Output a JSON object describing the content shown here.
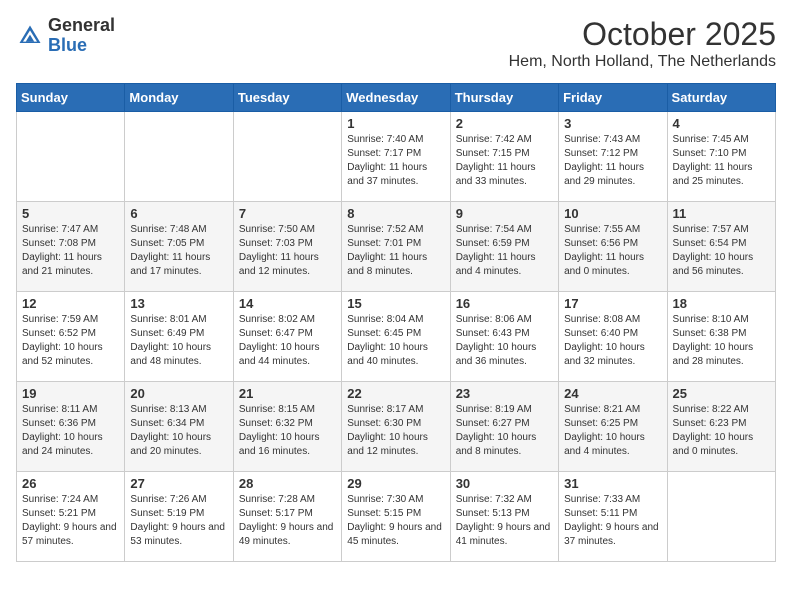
{
  "logo": {
    "general": "General",
    "blue": "Blue"
  },
  "header": {
    "month": "October 2025",
    "location": "Hem, North Holland, The Netherlands"
  },
  "weekdays": [
    "Sunday",
    "Monday",
    "Tuesday",
    "Wednesday",
    "Thursday",
    "Friday",
    "Saturday"
  ],
  "weeks": [
    [
      {
        "day": "",
        "sunrise": "",
        "sunset": "",
        "daylight": ""
      },
      {
        "day": "",
        "sunrise": "",
        "sunset": "",
        "daylight": ""
      },
      {
        "day": "",
        "sunrise": "",
        "sunset": "",
        "daylight": ""
      },
      {
        "day": "1",
        "sunrise": "Sunrise: 7:40 AM",
        "sunset": "Sunset: 7:17 PM",
        "daylight": "Daylight: 11 hours and 37 minutes."
      },
      {
        "day": "2",
        "sunrise": "Sunrise: 7:42 AM",
        "sunset": "Sunset: 7:15 PM",
        "daylight": "Daylight: 11 hours and 33 minutes."
      },
      {
        "day": "3",
        "sunrise": "Sunrise: 7:43 AM",
        "sunset": "Sunset: 7:12 PM",
        "daylight": "Daylight: 11 hours and 29 minutes."
      },
      {
        "day": "4",
        "sunrise": "Sunrise: 7:45 AM",
        "sunset": "Sunset: 7:10 PM",
        "daylight": "Daylight: 11 hours and 25 minutes."
      }
    ],
    [
      {
        "day": "5",
        "sunrise": "Sunrise: 7:47 AM",
        "sunset": "Sunset: 7:08 PM",
        "daylight": "Daylight: 11 hours and 21 minutes."
      },
      {
        "day": "6",
        "sunrise": "Sunrise: 7:48 AM",
        "sunset": "Sunset: 7:05 PM",
        "daylight": "Daylight: 11 hours and 17 minutes."
      },
      {
        "day": "7",
        "sunrise": "Sunrise: 7:50 AM",
        "sunset": "Sunset: 7:03 PM",
        "daylight": "Daylight: 11 hours and 12 minutes."
      },
      {
        "day": "8",
        "sunrise": "Sunrise: 7:52 AM",
        "sunset": "Sunset: 7:01 PM",
        "daylight": "Daylight: 11 hours and 8 minutes."
      },
      {
        "day": "9",
        "sunrise": "Sunrise: 7:54 AM",
        "sunset": "Sunset: 6:59 PM",
        "daylight": "Daylight: 11 hours and 4 minutes."
      },
      {
        "day": "10",
        "sunrise": "Sunrise: 7:55 AM",
        "sunset": "Sunset: 6:56 PM",
        "daylight": "Daylight: 11 hours and 0 minutes."
      },
      {
        "day": "11",
        "sunrise": "Sunrise: 7:57 AM",
        "sunset": "Sunset: 6:54 PM",
        "daylight": "Daylight: 10 hours and 56 minutes."
      }
    ],
    [
      {
        "day": "12",
        "sunrise": "Sunrise: 7:59 AM",
        "sunset": "Sunset: 6:52 PM",
        "daylight": "Daylight: 10 hours and 52 minutes."
      },
      {
        "day": "13",
        "sunrise": "Sunrise: 8:01 AM",
        "sunset": "Sunset: 6:49 PM",
        "daylight": "Daylight: 10 hours and 48 minutes."
      },
      {
        "day": "14",
        "sunrise": "Sunrise: 8:02 AM",
        "sunset": "Sunset: 6:47 PM",
        "daylight": "Daylight: 10 hours and 44 minutes."
      },
      {
        "day": "15",
        "sunrise": "Sunrise: 8:04 AM",
        "sunset": "Sunset: 6:45 PM",
        "daylight": "Daylight: 10 hours and 40 minutes."
      },
      {
        "day": "16",
        "sunrise": "Sunrise: 8:06 AM",
        "sunset": "Sunset: 6:43 PM",
        "daylight": "Daylight: 10 hours and 36 minutes."
      },
      {
        "day": "17",
        "sunrise": "Sunrise: 8:08 AM",
        "sunset": "Sunset: 6:40 PM",
        "daylight": "Daylight: 10 hours and 32 minutes."
      },
      {
        "day": "18",
        "sunrise": "Sunrise: 8:10 AM",
        "sunset": "Sunset: 6:38 PM",
        "daylight": "Daylight: 10 hours and 28 minutes."
      }
    ],
    [
      {
        "day": "19",
        "sunrise": "Sunrise: 8:11 AM",
        "sunset": "Sunset: 6:36 PM",
        "daylight": "Daylight: 10 hours and 24 minutes."
      },
      {
        "day": "20",
        "sunrise": "Sunrise: 8:13 AM",
        "sunset": "Sunset: 6:34 PM",
        "daylight": "Daylight: 10 hours and 20 minutes."
      },
      {
        "day": "21",
        "sunrise": "Sunrise: 8:15 AM",
        "sunset": "Sunset: 6:32 PM",
        "daylight": "Daylight: 10 hours and 16 minutes."
      },
      {
        "day": "22",
        "sunrise": "Sunrise: 8:17 AM",
        "sunset": "Sunset: 6:30 PM",
        "daylight": "Daylight: 10 hours and 12 minutes."
      },
      {
        "day": "23",
        "sunrise": "Sunrise: 8:19 AM",
        "sunset": "Sunset: 6:27 PM",
        "daylight": "Daylight: 10 hours and 8 minutes."
      },
      {
        "day": "24",
        "sunrise": "Sunrise: 8:21 AM",
        "sunset": "Sunset: 6:25 PM",
        "daylight": "Daylight: 10 hours and 4 minutes."
      },
      {
        "day": "25",
        "sunrise": "Sunrise: 8:22 AM",
        "sunset": "Sunset: 6:23 PM",
        "daylight": "Daylight: 10 hours and 0 minutes."
      }
    ],
    [
      {
        "day": "26",
        "sunrise": "Sunrise: 7:24 AM",
        "sunset": "Sunset: 5:21 PM",
        "daylight": "Daylight: 9 hours and 57 minutes."
      },
      {
        "day": "27",
        "sunrise": "Sunrise: 7:26 AM",
        "sunset": "Sunset: 5:19 PM",
        "daylight": "Daylight: 9 hours and 53 minutes."
      },
      {
        "day": "28",
        "sunrise": "Sunrise: 7:28 AM",
        "sunset": "Sunset: 5:17 PM",
        "daylight": "Daylight: 9 hours and 49 minutes."
      },
      {
        "day": "29",
        "sunrise": "Sunrise: 7:30 AM",
        "sunset": "Sunset: 5:15 PM",
        "daylight": "Daylight: 9 hours and 45 minutes."
      },
      {
        "day": "30",
        "sunrise": "Sunrise: 7:32 AM",
        "sunset": "Sunset: 5:13 PM",
        "daylight": "Daylight: 9 hours and 41 minutes."
      },
      {
        "day": "31",
        "sunrise": "Sunrise: 7:33 AM",
        "sunset": "Sunset: 5:11 PM",
        "daylight": "Daylight: 9 hours and 37 minutes."
      },
      {
        "day": "",
        "sunrise": "",
        "sunset": "",
        "daylight": ""
      }
    ]
  ]
}
